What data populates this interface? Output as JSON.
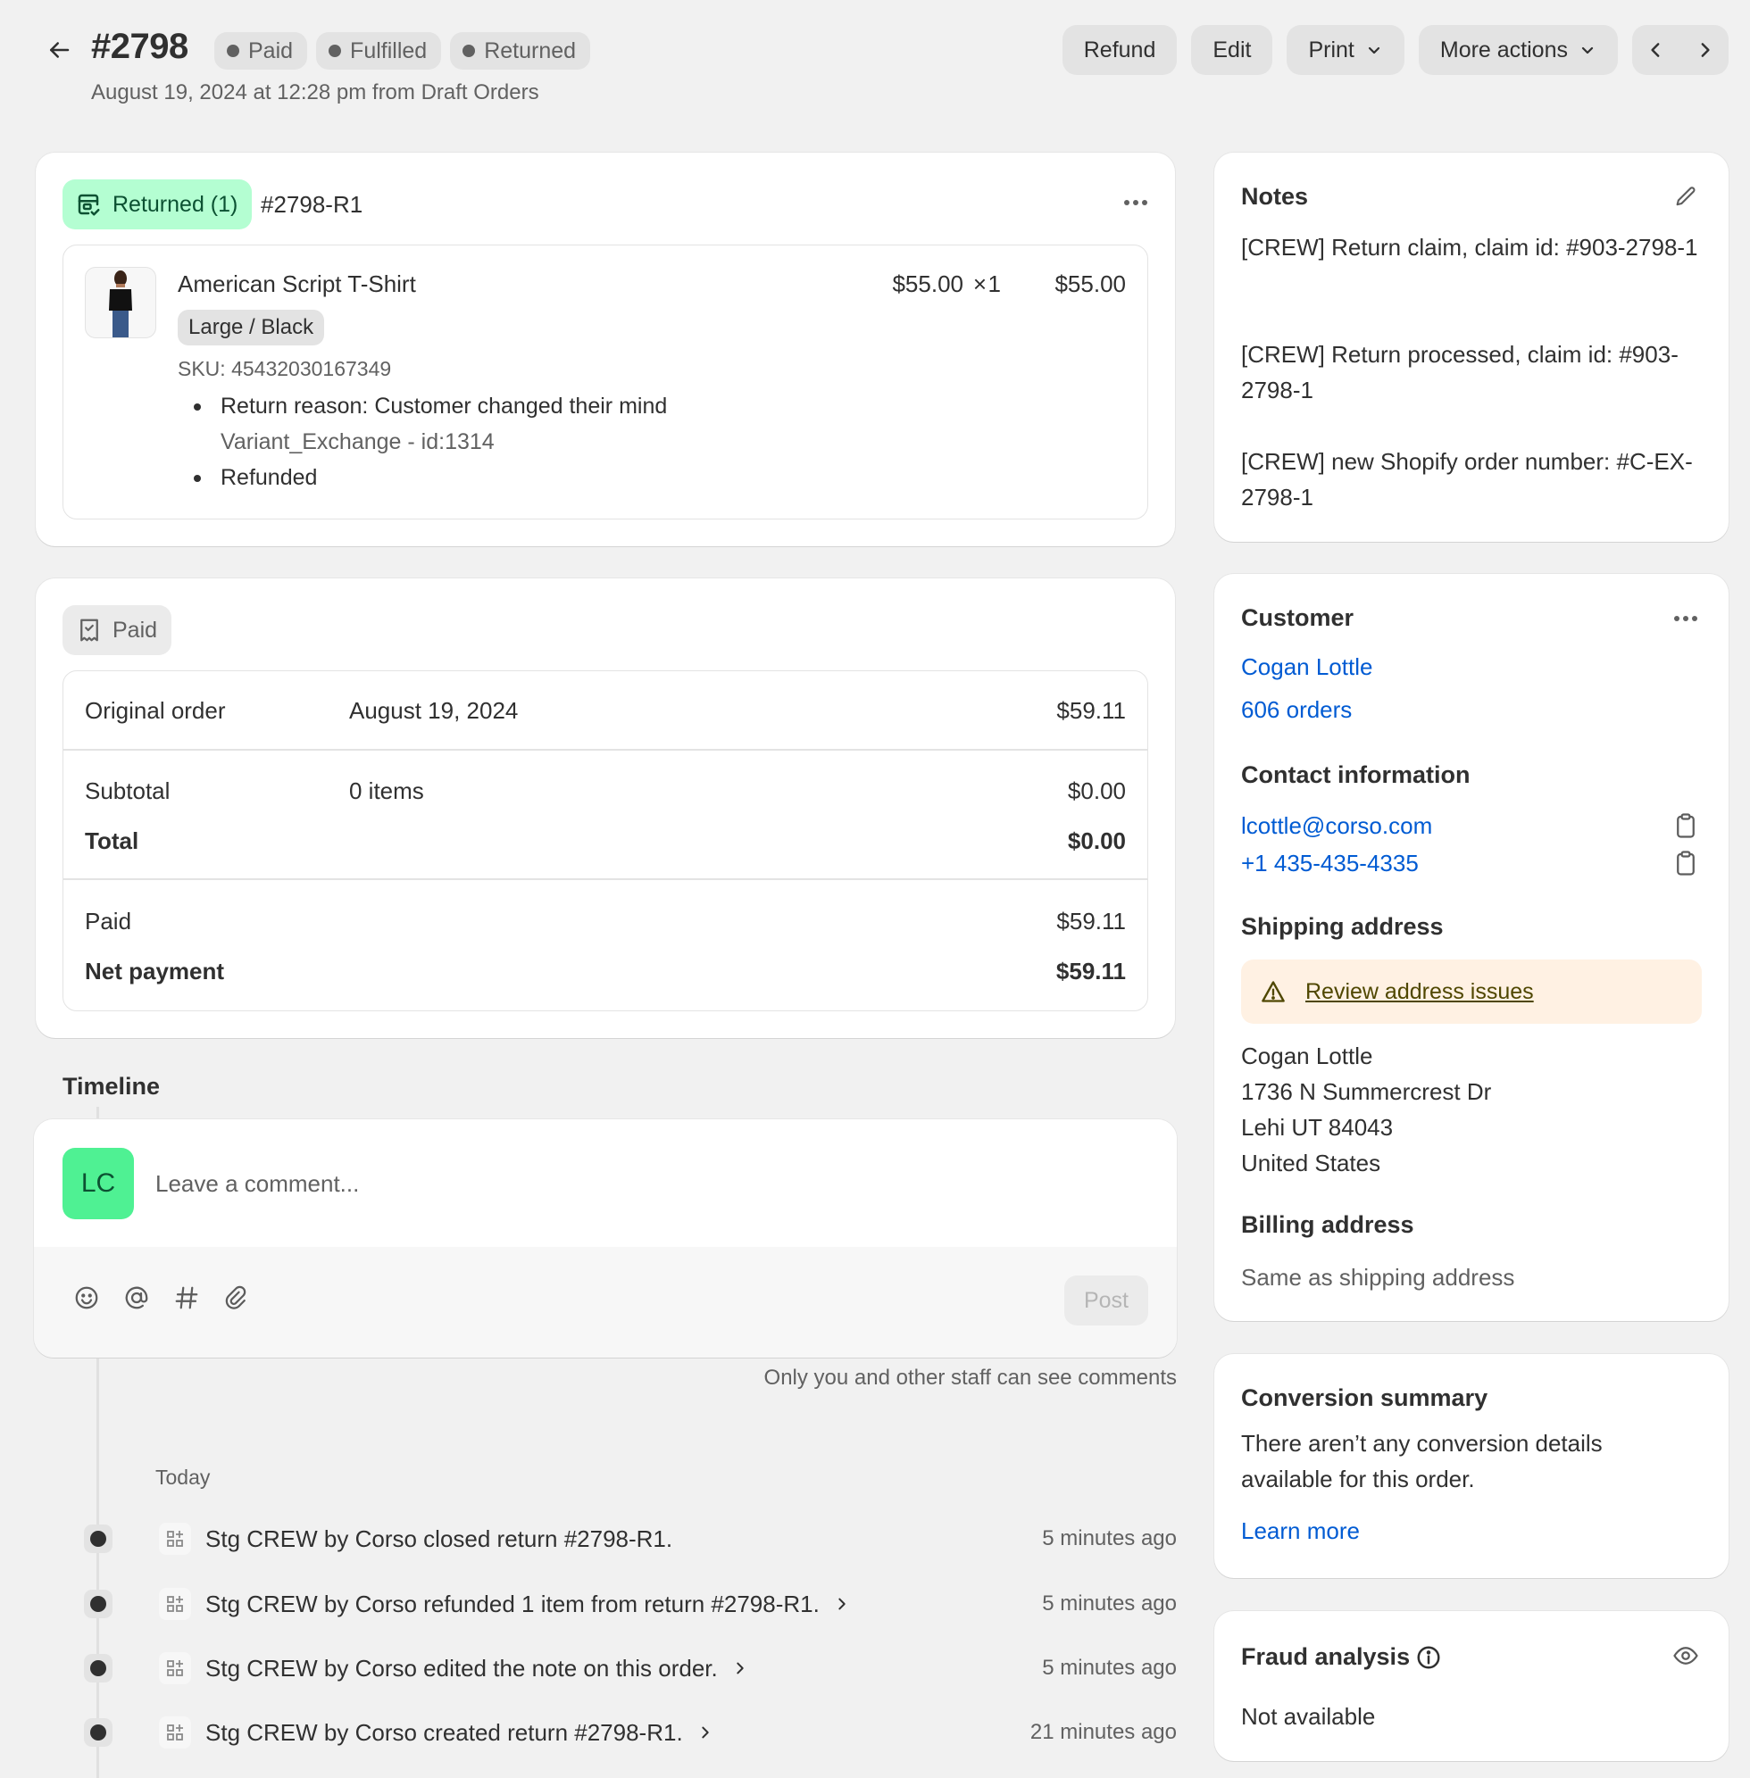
{
  "header": {
    "back_icon": "arrow-left-icon",
    "order_number": "#2798",
    "status_badges": [
      {
        "label": "Paid"
      },
      {
        "label": "Fulfilled"
      },
      {
        "label": "Returned"
      }
    ],
    "subtitle": "August 19, 2024 at 12:28 pm from Draft Orders",
    "actions": {
      "refund": "Refund",
      "edit": "Edit",
      "print": "Print",
      "more_actions": "More actions"
    }
  },
  "return_card": {
    "status_label": "Returned (1)",
    "return_id": "#2798-R1",
    "status_color": "#b4fed2",
    "item": {
      "name": "American Script T-Shirt",
      "variant": "Large / Black",
      "sku": "SKU: 45432030167349",
      "unit_price": "$55.00",
      "times": "×",
      "quantity": "1",
      "line_total": "$55.00",
      "return_reason": "Return reason: Customer changed their mind",
      "return_reason_detail": "Variant_Exchange - id:1314",
      "refund_status": "Refunded"
    }
  },
  "payment_card": {
    "status_label": "Paid",
    "original_order": {
      "label": "Original order",
      "date": "August 19, 2024",
      "amount": "$59.11"
    },
    "subtotal": {
      "label": "Subtotal",
      "items": "0 items",
      "amount": "$0.00"
    },
    "total": {
      "label": "Total",
      "amount": "$0.00"
    },
    "paid": {
      "label": "Paid",
      "amount": "$59.11"
    },
    "net_payment": {
      "label": "Net payment",
      "amount": "$59.11"
    }
  },
  "timeline": {
    "heading": "Timeline",
    "avatar_initials": "LC",
    "avatar_color": "#4ff193",
    "comment_placeholder": "Leave a comment...",
    "post_label": "Post",
    "staff_note": "Only you and other staff can see comments",
    "date_group": "Today",
    "events": [
      {
        "message": "Stg CREW by Corso closed return #2798-R1.",
        "time": "5 minutes ago",
        "has_chevron": false
      },
      {
        "message": "Stg CREW by Corso refunded 1 item from return #2798-R1.",
        "time": "5 minutes ago",
        "has_chevron": true
      },
      {
        "message": "Stg CREW by Corso edited the note on this order.",
        "time": "5 minutes ago",
        "has_chevron": true
      },
      {
        "message": "Stg CREW by Corso created return #2798-R1.",
        "time": "21 minutes ago",
        "has_chevron": true
      }
    ]
  },
  "notes": {
    "title": "Notes",
    "lines": [
      "[CREW] Return claim, claim id: #903-2798-1",
      "[CREW] Return processed, claim id: #903-2798-1",
      "[CREW] new Shopify order number: #C-EX-2798-1"
    ]
  },
  "customer": {
    "title": "Customer",
    "name": "Cogan Lottle",
    "orders": "606 orders",
    "contact_title": "Contact information",
    "email": "lcottle@corso.com",
    "phone": "+1 435-435-4335",
    "shipping_title": "Shipping address",
    "address_warning": "Review address issues",
    "shipping_address": [
      "Cogan Lottle",
      "1736 N Summercrest Dr",
      "Lehi UT 84043",
      "United States"
    ],
    "billing_title": "Billing address",
    "billing_value": "Same as shipping address"
  },
  "conversion": {
    "title": "Conversion summary",
    "text": "There aren’t any conversion details available for this order.",
    "link": "Learn more"
  },
  "fraud": {
    "title": "Fraud analysis",
    "value": "Not available"
  }
}
